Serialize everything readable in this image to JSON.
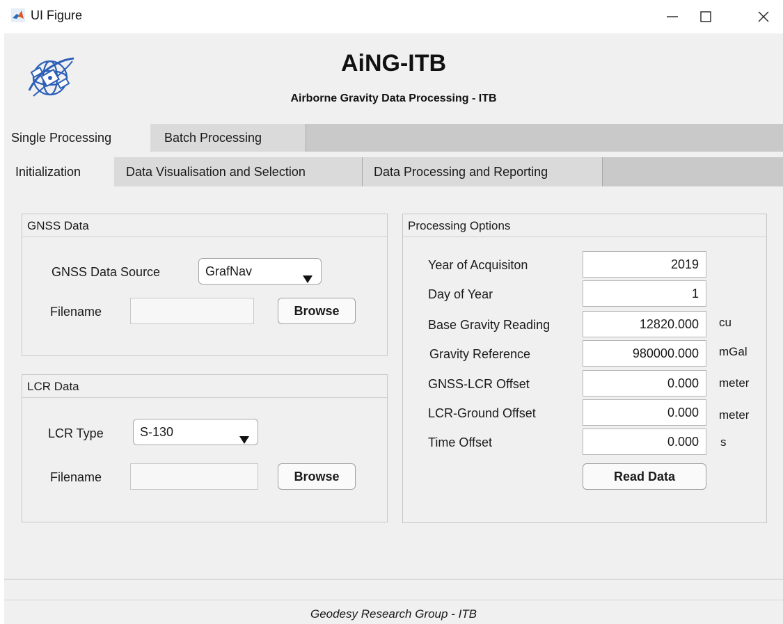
{
  "window": {
    "title": "UI Figure",
    "icon": "matlab-icon",
    "controls": [
      "minimize-icon",
      "maximize-icon",
      "close-icon"
    ]
  },
  "header": {
    "logo": "satellite-globe-icon",
    "title": "AiNG-ITB",
    "subtitle": "Airborne Gravity Data Processing - ITB"
  },
  "outer_tabs": {
    "items": [
      {
        "label": "Single Processing",
        "active": true
      },
      {
        "label": "Batch Processing",
        "active": false
      }
    ]
  },
  "inner_tabs": {
    "items": [
      {
        "label": "Initialization",
        "active": true
      },
      {
        "label": "Data Visualisation and Selection",
        "active": false
      },
      {
        "label": "Data Processing and Reporting",
        "active": false
      }
    ]
  },
  "gnss_panel": {
    "title": "GNSS Data",
    "source_label": "GNSS Data Source",
    "source_value": "GrafNav",
    "filename_label": "Filename",
    "filename_value": "",
    "browse_label": "Browse"
  },
  "lcr_panel": {
    "title": "LCR Data",
    "type_label": "LCR Type",
    "type_value": "S-130",
    "filename_label": "Filename",
    "filename_value": "",
    "browse_label": "Browse"
  },
  "options_panel": {
    "title": "Processing Options",
    "rows": [
      {
        "label": "Year of Acquisiton",
        "value": "2019",
        "unit": ""
      },
      {
        "label": "Day of Year",
        "value": "1",
        "unit": ""
      },
      {
        "label": "Base Gravity Reading",
        "value": "12820.000",
        "unit": "cu"
      },
      {
        "label": "Gravity Reference",
        "value": "980000.000",
        "unit": "mGal"
      },
      {
        "label": "GNSS-LCR Offset",
        "value": "0.000",
        "unit": "meter"
      },
      {
        "label": "LCR-Ground Offset",
        "value": "0.000",
        "unit": "meter"
      },
      {
        "label": "Time Offset",
        "value": "0.000",
        "unit": "s"
      }
    ],
    "read_label": "Read Data"
  },
  "footer": {
    "text": "Geodesy Research Group - ITB"
  },
  "colors": {
    "background": "#f0f0f0",
    "tabstrip": "#c9c9c9",
    "matlab_orange": "#d9561e",
    "logo_blue": "#2b5fb8"
  }
}
